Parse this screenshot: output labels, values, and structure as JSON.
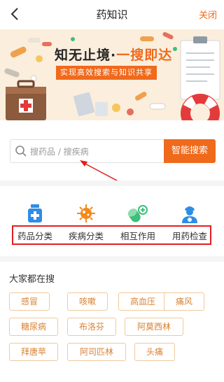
{
  "header": {
    "title": "药知识",
    "close_label": "关闭"
  },
  "banner": {
    "title_main": "知无止境·",
    "title_accent": "一搜即达",
    "subtitle": "实现高效搜索与知识共享"
  },
  "search": {
    "placeholder": "搜药品 / 搜疾病",
    "button_label": "智能搜索"
  },
  "categories": [
    {
      "label": "药品分类",
      "icon": "medicine-bottle-icon"
    },
    {
      "label": "疾病分类",
      "icon": "virus-icon"
    },
    {
      "label": "相互作用",
      "icon": "pill-interaction-icon"
    },
    {
      "label": "用药检查",
      "icon": "doctor-icon"
    }
  ],
  "popular": {
    "title": "大家都在搜",
    "tags": [
      "感冒",
      "咳嗽",
      "高血压",
      "痛风",
      "糖尿病",
      "布洛芬",
      "阿莫西林",
      "拜唐苹",
      "阿司匹林",
      "头痛"
    ]
  },
  "colors": {
    "accent": "#f06a1c",
    "icon_blue": "#2f8de4",
    "icon_orange": "#f28a1a",
    "icon_green": "#3cc07a",
    "annotation_red": "#e02020",
    "tag_border": "#f3c99c",
    "tag_text": "#d9822f"
  }
}
